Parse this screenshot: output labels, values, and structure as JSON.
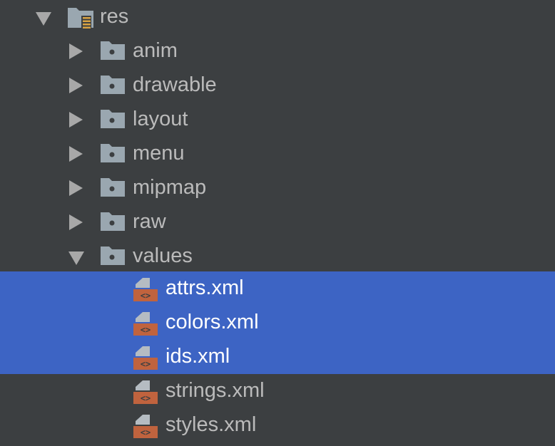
{
  "tree": {
    "root": {
      "label": "res",
      "expanded": true,
      "icon": "resource-folder-icon"
    },
    "folders": [
      {
        "label": "anim",
        "expanded": false,
        "icon": "folder-icon"
      },
      {
        "label": "drawable",
        "expanded": false,
        "icon": "folder-icon"
      },
      {
        "label": "layout",
        "expanded": false,
        "icon": "folder-icon"
      },
      {
        "label": "menu",
        "expanded": false,
        "icon": "folder-icon"
      },
      {
        "label": "mipmap",
        "expanded": false,
        "icon": "folder-icon"
      },
      {
        "label": "raw",
        "expanded": false,
        "icon": "folder-icon"
      },
      {
        "label": "values",
        "expanded": true,
        "icon": "folder-icon"
      }
    ],
    "files": [
      {
        "label": "attrs.xml",
        "selected": true,
        "icon": "xml-file-icon"
      },
      {
        "label": "colors.xml",
        "selected": true,
        "icon": "xml-file-icon"
      },
      {
        "label": "ids.xml",
        "selected": true,
        "icon": "xml-file-icon"
      },
      {
        "label": "strings.xml",
        "selected": false,
        "icon": "xml-file-icon"
      },
      {
        "label": "styles.xml",
        "selected": false,
        "icon": "xml-file-icon"
      }
    ]
  },
  "colors": {
    "background": "#3c3f41",
    "selection": "#3d64c4",
    "text": "#bbbbbb",
    "folder_icon": "#9aa7b0",
    "xml_badge": "#c0633e"
  }
}
